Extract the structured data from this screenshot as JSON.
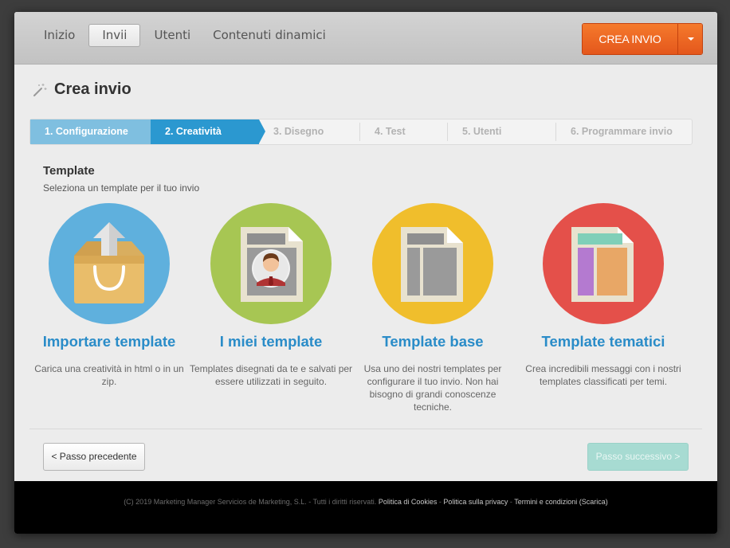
{
  "nav": {
    "items": [
      {
        "label": "Inizio"
      },
      {
        "label": "Invii"
      },
      {
        "label": "Utenti"
      },
      {
        "label": "Contenuti dinamici"
      }
    ],
    "create_button": "CREA INVIO"
  },
  "page": {
    "title": "Crea invio"
  },
  "steps": [
    {
      "label": "1. Configurazione"
    },
    {
      "label": "2. Creatività"
    },
    {
      "label": "3. Disegno"
    },
    {
      "label": "4. Test"
    },
    {
      "label": "5. Utenti"
    },
    {
      "label": "6. Programmare invio"
    }
  ],
  "section": {
    "title": "Template",
    "subtitle": "Seleziona un template per il tuo invio"
  },
  "cards": [
    {
      "title": "Importare template",
      "description": "Carica una creatività in html o in un zip.",
      "icon": "upload-box-icon",
      "color": "#5fb0dd"
    },
    {
      "title": "I miei template",
      "description": "Templates disegnati da te e salvati per essere utilizzati in seguito.",
      "icon": "user-template-icon",
      "color": "#a7c653"
    },
    {
      "title": "Template base",
      "description": "Usa uno dei nostri templates per configurare il tuo invio. Non hai bisogno di grandi conoscenze tecniche.",
      "icon": "base-template-icon",
      "color": "#f0be2c"
    },
    {
      "title": "Template tematici",
      "description": "Crea incredibili messaggi con i nostri templates classificati per temi.",
      "icon": "themed-template-icon",
      "color": "#e4504a"
    }
  ],
  "buttons": {
    "previous": "< Passo precedente",
    "next": "Passo successivo >"
  },
  "footer": {
    "copyright": "(C) 2019 Marketing Manager Servicios de Marketing, S.L. - Tutti i diritti riservati.",
    "cookies": "Politica di Cookies",
    "privacy": "Politica sulla privacy",
    "terms": "Termini e condizioni (Scarica)",
    "sep": " - "
  }
}
